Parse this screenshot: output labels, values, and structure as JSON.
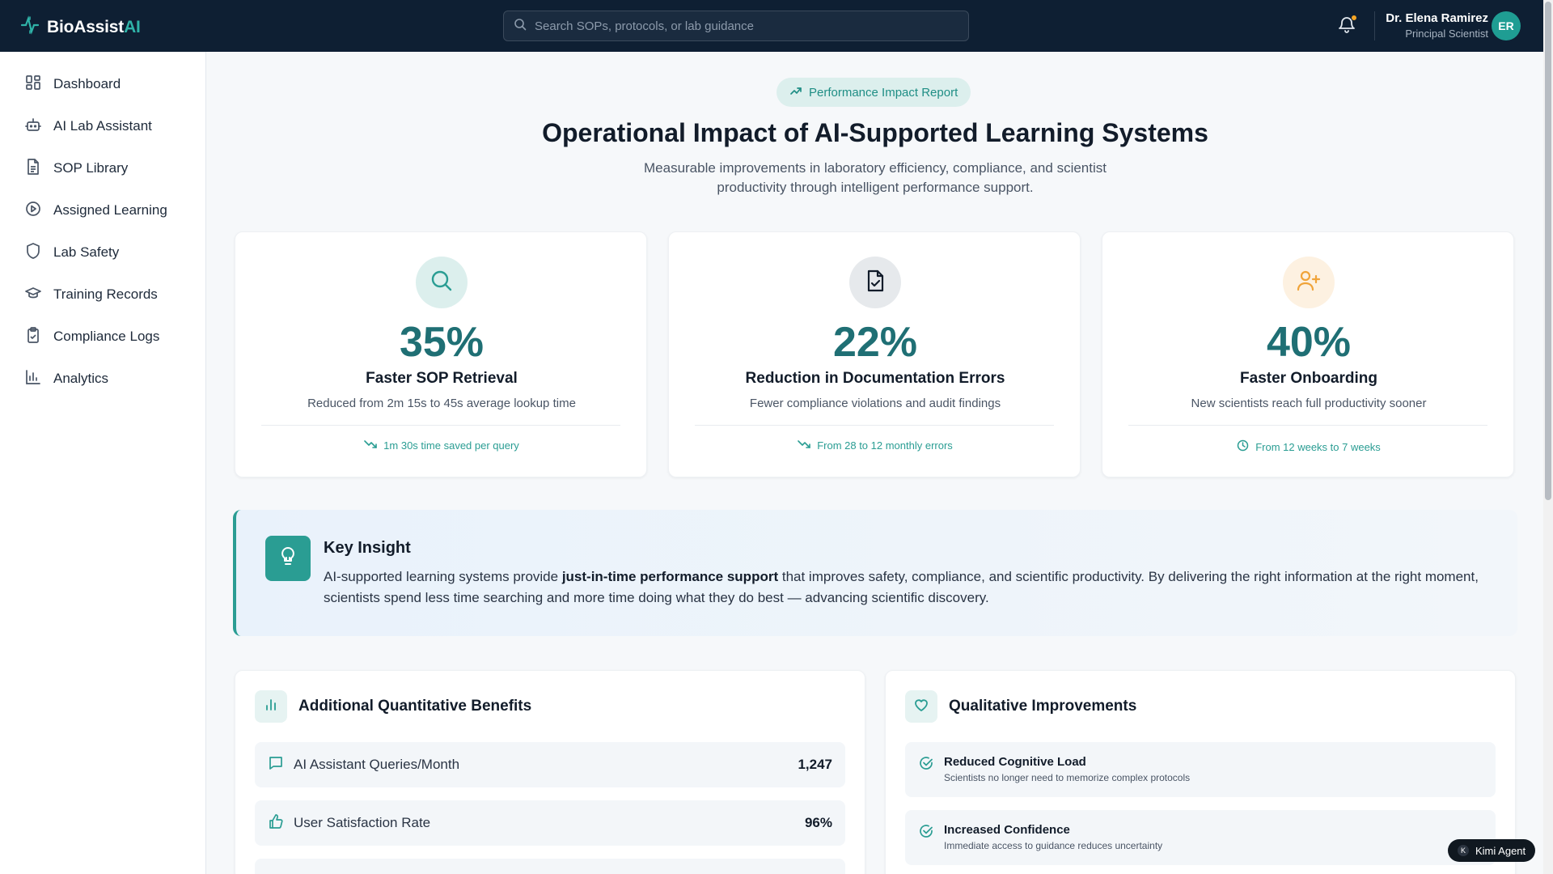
{
  "app": {
    "brand_main": "BioAssist",
    "brand_ai": "AI",
    "accent": "#2a9d93",
    "topbar_bg": "#0e1f33"
  },
  "search": {
    "placeholder": "Search SOPs, protocols, or lab guidance"
  },
  "user": {
    "name": "Dr. Elena Ramirez",
    "role": "Principal Scientist",
    "initials": "ER",
    "has_notification": true
  },
  "sidebar": {
    "items": [
      {
        "label": "Dashboard",
        "icon": "grid-icon"
      },
      {
        "label": "AI Lab Assistant",
        "icon": "robot-icon"
      },
      {
        "label": "SOP Library",
        "icon": "document-icon"
      },
      {
        "label": "Assigned Learning",
        "icon": "play-circle-icon"
      },
      {
        "label": "Lab Safety",
        "icon": "shield-icon"
      },
      {
        "label": "Training Records",
        "icon": "graduation-cap-icon"
      },
      {
        "label": "Compliance Logs",
        "icon": "clipboard-check-icon"
      },
      {
        "label": "Analytics",
        "icon": "bar-chart-icon"
      }
    ]
  },
  "report": {
    "pill": "Performance Impact Report",
    "title": "Operational Impact of AI-Supported Learning Systems",
    "subtitle": "Measurable improvements in laboratory efficiency, compliance, and scientist productivity through intelligent performance support."
  },
  "cards": [
    {
      "value": "35%",
      "title": "Faster SOP Retrieval",
      "desc": "Reduced from 2m 15s to 45s average lookup time",
      "foot": "1m 30s time saved per query",
      "icon": "search-icon",
      "icon_bg": "#dcefed",
      "foot_icon": "trending-down-icon"
    },
    {
      "value": "22%",
      "title": "Reduction in Documentation Errors",
      "desc": "Fewer compliance violations and audit findings",
      "foot": "From 28 to 12 monthly errors",
      "icon": "file-check-icon",
      "icon_bg": "#e6e9ec",
      "foot_icon": "trending-down-icon"
    },
    {
      "value": "40%",
      "title": "Faster Onboarding",
      "desc": "New scientists reach full productivity sooner",
      "foot": "From 12 weeks to 7 weeks",
      "icon": "user-plus-icon",
      "icon_bg": "#fdf1e1",
      "foot_icon": "clock-icon"
    }
  ],
  "insight": {
    "title": "Key Insight",
    "text_before": "AI-supported learning systems provide ",
    "text_bold": "just-in-time performance support",
    "text_after": " that improves safety, compliance, and scientific productivity. By delivering the right information at the right moment, scientists spend less time searching and more time doing what they do best — advancing scientific discovery."
  },
  "quant": {
    "title": "Additional Quantitative Benefits",
    "rows": [
      {
        "label": "AI Assistant Queries/Month",
        "value": "1,247",
        "icon": "message-square-icon"
      },
      {
        "label": "User Satisfaction Rate",
        "value": "96%",
        "icon": "thumbs-up-icon"
      }
    ]
  },
  "qual": {
    "title": "Qualitative Improvements",
    "rows": [
      {
        "title": "Reduced Cognitive Load",
        "desc": "Scientists no longer need to memorize complex protocols"
      },
      {
        "title": "Increased Confidence",
        "desc": "Immediate access to guidance reduces uncertainty"
      }
    ]
  },
  "agent_badge": "Kimi Agent"
}
